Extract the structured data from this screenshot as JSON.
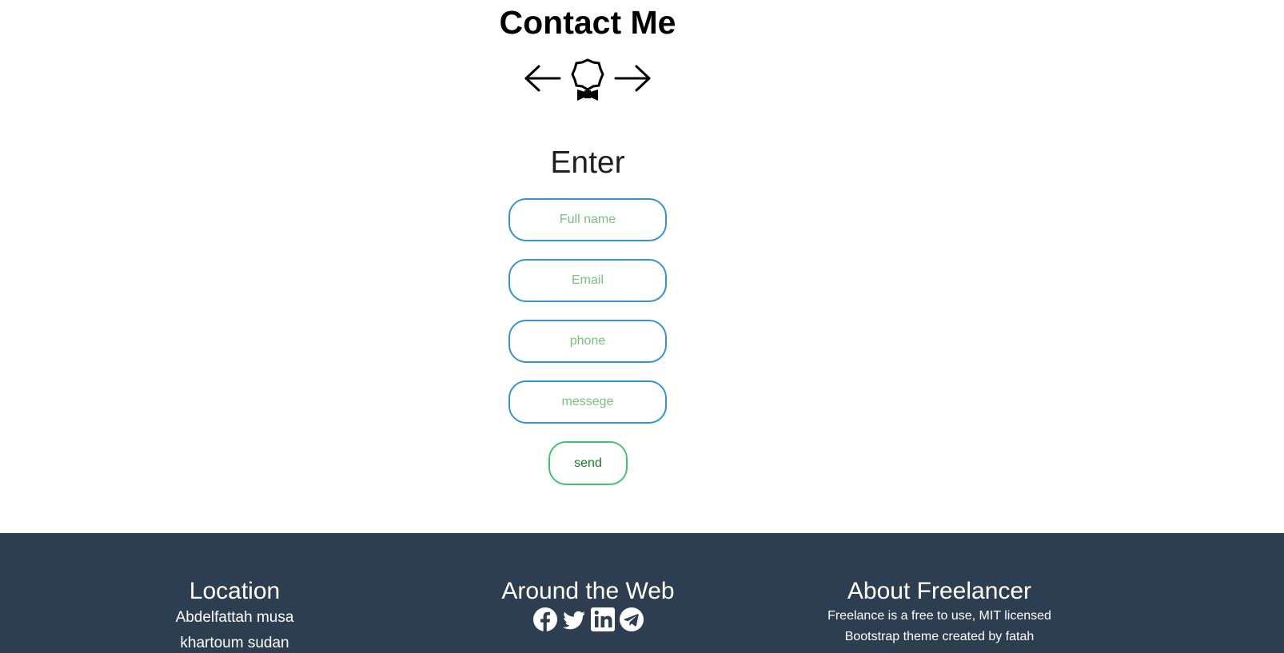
{
  "contact": {
    "title": "Contact Me",
    "divider_icon": "award-icon",
    "form_heading": "Enter",
    "fields": {
      "full_name_placeholder": "Full name",
      "email_placeholder": "Email",
      "phone_placeholder": "phone",
      "message_placeholder": "messege"
    },
    "send_label": "send"
  },
  "footer": {
    "location": {
      "heading": "Location",
      "line1": "Abdelfattah musa",
      "line2": "khartoum sudan"
    },
    "web": {
      "heading": "Around the Web",
      "icons": [
        "facebook-icon",
        "twitter-icon",
        "linkedin-icon",
        "telegram-icon"
      ]
    },
    "about": {
      "heading": "About Freelancer",
      "line1": "Freelance is a free to use, MIT licensed",
      "line2": "Bootstrap theme created by fatah"
    }
  },
  "colors": {
    "footer_bg": "#2c3e50",
    "input_border": "#3592d3",
    "placeholder": "#7bbf7c",
    "send_border": "#3fc46d",
    "send_text": "#157a1f"
  }
}
